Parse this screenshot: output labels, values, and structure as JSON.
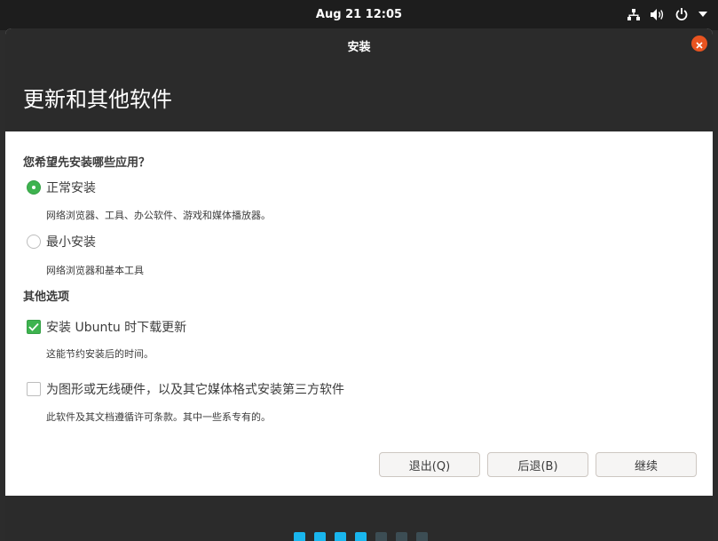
{
  "topbar": {
    "clock": "Aug 21  12:05",
    "icons": [
      "network-icon",
      "volume-icon",
      "power-icon",
      "chevron-down-icon"
    ]
  },
  "window": {
    "title": "安装",
    "page_title": "更新和其他软件"
  },
  "apps_section": {
    "question": "您希望先安装哪些应用？",
    "normal": {
      "label": "正常安装",
      "desc": "网络浏览器、工具、办公软件、游戏和媒体播放器。",
      "selected": true
    },
    "minimal": {
      "label": "最小安装",
      "desc": "网络浏览器和基本工具",
      "selected": false
    }
  },
  "other_section": {
    "title": "其他选项",
    "updates": {
      "label": "安装 Ubuntu 时下载更新",
      "desc": "这能节约安装后的时间。",
      "checked": true
    },
    "third_party": {
      "label": "为图形或无线硬件，以及其它媒体格式安装第三方软件",
      "desc": "此软件及其文档遵循许可条款。其中一些系专有的。",
      "checked": false
    }
  },
  "buttons": {
    "quit": "退出(Q)",
    "back": "后退(B)",
    "continue": "继续"
  },
  "progress": {
    "steps_total": 7,
    "steps_done": 4
  },
  "colors": {
    "accent": "#3eb34f",
    "close": "#e95420",
    "dot_active": "#19b6ee",
    "dot_inactive": "#3c4d54"
  }
}
